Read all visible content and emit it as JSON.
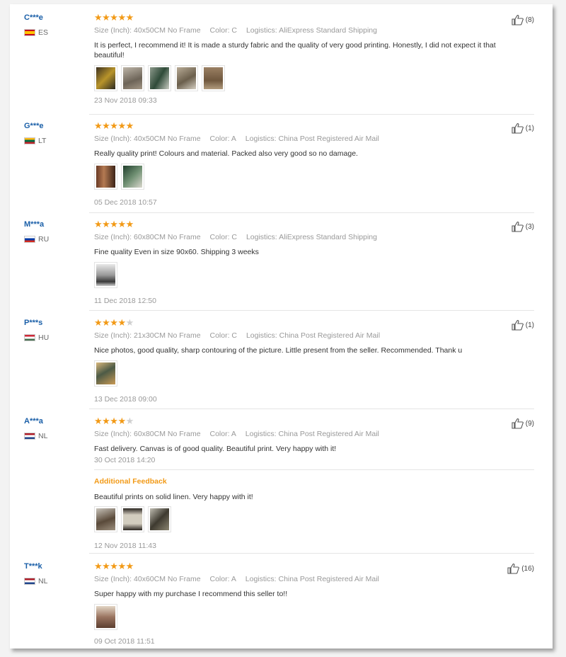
{
  "labels": {
    "size": "Size (Inch):",
    "color": "Color:",
    "logistics": "Logistics:",
    "additional": "Additional Feedback"
  },
  "colors": {
    "star": "#f29a17",
    "user": "#1a5fa8",
    "accent": "#f29a17"
  },
  "reviews": [
    {
      "user": "C***e",
      "country": "ES",
      "rating": 5,
      "likes": "(8)",
      "size": "40x50CM No Frame",
      "color": "C",
      "logistics": "AliExpress Standard Shipping",
      "text": "It is perfect, I recommend it! It is made a sturdy fabric and the quality of very good printing. Honestly, I did not expect it that beautiful!",
      "photos": 5,
      "date": "23 Nov 2018 09:33"
    },
    {
      "user": "G***e",
      "country": "LT",
      "rating": 5,
      "likes": "(1)",
      "size": "40x50CM No Frame",
      "color": "A",
      "logistics": "China Post Registered Air Mail",
      "text": "Really quality print! Colours and material. Packed also very good so no damage.",
      "photos": 2,
      "date": "05 Dec 2018 10:57"
    },
    {
      "user": "M***a",
      "country": "RU",
      "rating": 5,
      "likes": "(3)",
      "size": "60x80CM No Frame",
      "color": "C",
      "logistics": "AliExpress Standard Shipping",
      "text": "Fine quality Even in size 90x60. Shipping 3 weeks",
      "photos": 1,
      "date": "11 Dec 2018 12:50"
    },
    {
      "user": "P***s",
      "country": "HU",
      "rating": 4,
      "likes": "(1)",
      "size": "21x30CM No Frame",
      "color": "C",
      "logistics": "China Post Registered Air Mail",
      "text": "Nice photos, good quality, sharp contouring of the picture. Little present from the seller. Recommended. Thank u",
      "photos": 1,
      "date": "13 Dec 2018 09:00"
    },
    {
      "user": "A***a",
      "country": "NL",
      "rating": 4,
      "likes": "(9)",
      "size": "60x80CM No Frame",
      "color": "A",
      "logistics": "China Post Registered Air Mail",
      "text": "Fast delivery. Canvas is of good quality. Beautiful print. Very happy with it!",
      "date": "30 Oct 2018 14:20",
      "additional": {
        "text": "Beautiful prints on solid linen. Very happy with it!",
        "photos": 3,
        "date": "12 Nov 2018 11:43"
      }
    },
    {
      "user": "T***k",
      "country": "NL",
      "rating": 5,
      "likes": "(16)",
      "size": "40x60CM No Frame",
      "color": "A",
      "logistics": "China Post Registered Air Mail",
      "text": "Super happy with my purchase I recommend this seller to!!",
      "photos": 1,
      "date": "09 Oct 2018 11:51"
    }
  ]
}
